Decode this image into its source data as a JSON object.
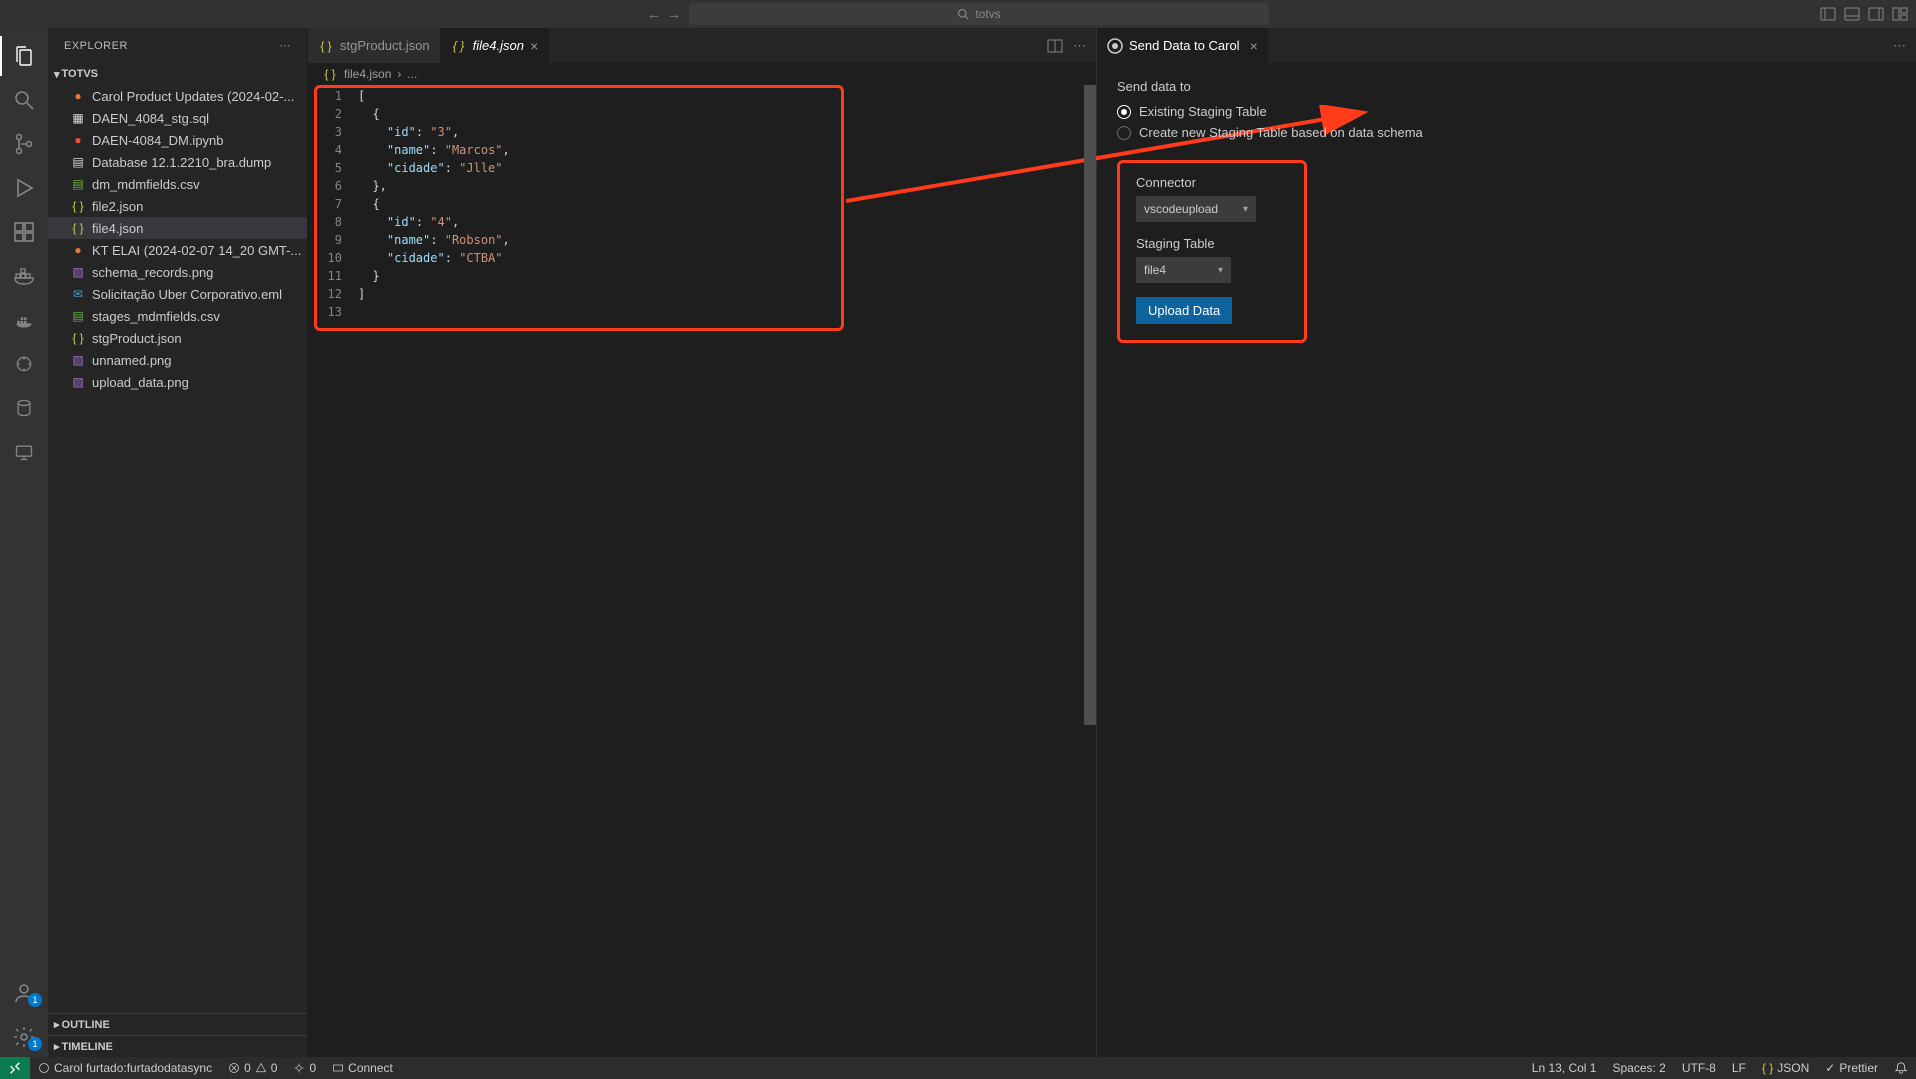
{
  "titlebar": {
    "search_placeholder": "totvs"
  },
  "explorer": {
    "title": "EXPLORER",
    "folder": "TOTVS",
    "files": [
      {
        "name": "Carol Product Updates (2024-02-...",
        "icon": "rec"
      },
      {
        "name": "DAEN_4084_stg.sql",
        "icon": "sql"
      },
      {
        "name": "DAEN-4084_DM.ipynb",
        "icon": "nb"
      },
      {
        "name": "Database 12.1.2210_bra.dump",
        "icon": "db"
      },
      {
        "name": "dm_mdmfields.csv",
        "icon": "csv"
      },
      {
        "name": "file2.json",
        "icon": "json"
      },
      {
        "name": "file4.json",
        "icon": "json",
        "selected": true
      },
      {
        "name": "KT ELAI (2024-02-07 14_20 GMT-...",
        "icon": "rec"
      },
      {
        "name": "schema_records.png",
        "icon": "png"
      },
      {
        "name": "Solicitação Uber Corporativo.eml",
        "icon": "eml"
      },
      {
        "name": "stages_mdmfields.csv",
        "icon": "csv"
      },
      {
        "name": "stgProduct.json",
        "icon": "json"
      },
      {
        "name": "unnamed.png",
        "icon": "png"
      },
      {
        "name": "upload_data.png",
        "icon": "png"
      }
    ],
    "outline": "OUTLINE",
    "timeline": "TIMELINE"
  },
  "tabs": [
    {
      "label": "stgProduct.json"
    },
    {
      "label": "file4.json",
      "active": true
    }
  ],
  "breadcrumb": {
    "file": "file4.json",
    "rest": "..."
  },
  "code": {
    "lines": [
      "[",
      "  {",
      "    \"id\": \"3\",",
      "    \"name\": \"Marcos\",",
      "    \"cidade\": \"Jlle\"",
      "  },",
      "  {",
      "    \"id\": \"4\",",
      "    \"name\": \"Robson\",",
      "    \"cidade\": \"CTBA\"",
      "  }",
      "]",
      ""
    ]
  },
  "right_panel": {
    "tab": "Send Data to Carol",
    "section_label": "Send data to",
    "options": [
      "Existing Staging Table",
      "Create new Staging Table based on data schema"
    ],
    "connector_label": "Connector",
    "connector_value": "vscodeupload",
    "staging_label": "Staging Table",
    "staging_value": "file4",
    "upload_btn": "Upload Data"
  },
  "statusbar": {
    "profile": "Carol furtado:furtadodatasync",
    "errors": "0",
    "warnings": "0",
    "ports": "0",
    "connect": "Connect",
    "cursor": "Ln 13, Col 1",
    "spaces": "Spaces: 2",
    "encoding": "UTF-8",
    "eol": "LF",
    "lang": "JSON",
    "formatter": "Prettier"
  }
}
